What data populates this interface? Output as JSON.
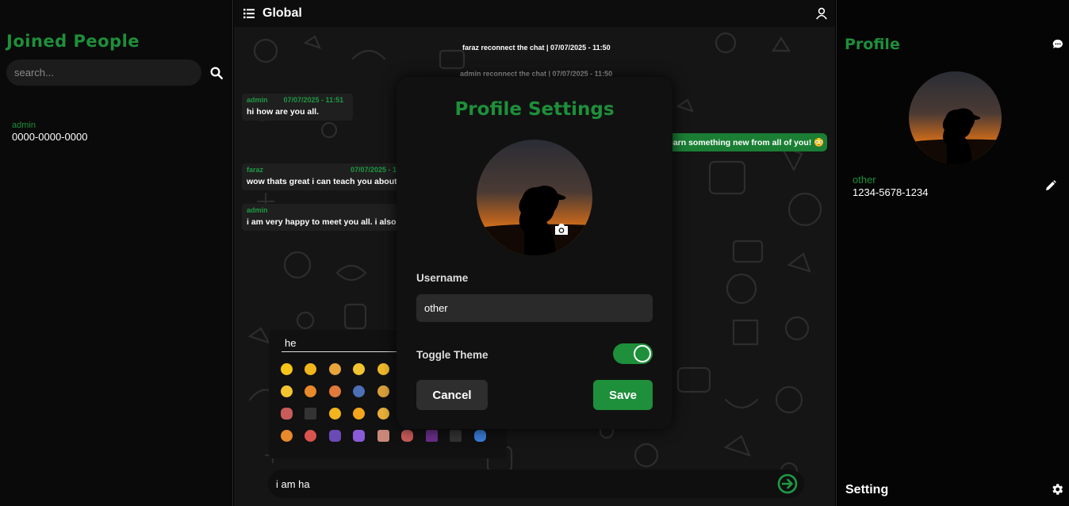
{
  "left_panel": {
    "title": "Joined People",
    "search_placeholder": "search...",
    "people": [
      {
        "name": "admin",
        "phone": "0000-0000-0000"
      }
    ]
  },
  "chat": {
    "title": "Global",
    "system_messages": [
      "faraz reconnect the chat | 07/07/2025 - 11:50",
      "admin reconnect the chat | 07/07/2025 - 11:50"
    ],
    "messages": [
      {
        "user": "admin",
        "time": "07/07/2025 - 11:51",
        "text": "hi how are you all."
      },
      {
        "user": "faraz",
        "time": "07/07/2025 - 11:51",
        "text": "wow thats great i can teach you about"
      },
      {
        "user": "admin",
        "time": "",
        "text": "i am very happy to meet you all. i also"
      }
    ],
    "own_message": "earn something new from all of you! 😳",
    "emoji_search": "he",
    "composer_text": "i am ha"
  },
  "modal": {
    "title": "Profile Settings",
    "username_label": "Username",
    "username_value": "other",
    "theme_label": "Toggle Theme",
    "theme_on": true,
    "cancel_label": "Cancel",
    "save_label": "Save"
  },
  "right_panel": {
    "title": "Profile",
    "name": "other",
    "phone": "1234-5678-1234",
    "setting_label": "Setting"
  },
  "colors": {
    "accent": "#1e8f3a",
    "bubble": "#1f1f1f",
    "own_bubble": "#1a7f34",
    "background": "#151515"
  }
}
